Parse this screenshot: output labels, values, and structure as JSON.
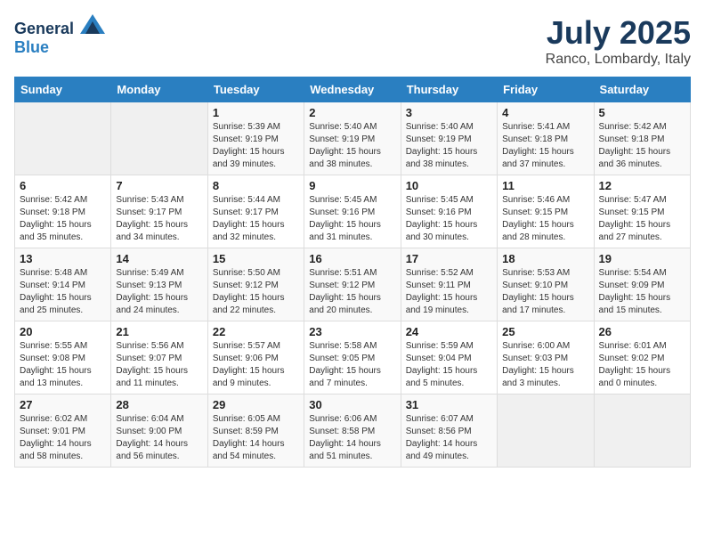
{
  "header": {
    "logo_general": "General",
    "logo_blue": "Blue",
    "month": "July 2025",
    "location": "Ranco, Lombardy, Italy"
  },
  "weekdays": [
    "Sunday",
    "Monday",
    "Tuesday",
    "Wednesday",
    "Thursday",
    "Friday",
    "Saturday"
  ],
  "weeks": [
    [
      {
        "day": "",
        "sunrise": "",
        "sunset": "",
        "daylight": ""
      },
      {
        "day": "",
        "sunrise": "",
        "sunset": "",
        "daylight": ""
      },
      {
        "day": "1",
        "sunrise": "Sunrise: 5:39 AM",
        "sunset": "Sunset: 9:19 PM",
        "daylight": "Daylight: 15 hours and 39 minutes."
      },
      {
        "day": "2",
        "sunrise": "Sunrise: 5:40 AM",
        "sunset": "Sunset: 9:19 PM",
        "daylight": "Daylight: 15 hours and 38 minutes."
      },
      {
        "day": "3",
        "sunrise": "Sunrise: 5:40 AM",
        "sunset": "Sunset: 9:19 PM",
        "daylight": "Daylight: 15 hours and 38 minutes."
      },
      {
        "day": "4",
        "sunrise": "Sunrise: 5:41 AM",
        "sunset": "Sunset: 9:18 PM",
        "daylight": "Daylight: 15 hours and 37 minutes."
      },
      {
        "day": "5",
        "sunrise": "Sunrise: 5:42 AM",
        "sunset": "Sunset: 9:18 PM",
        "daylight": "Daylight: 15 hours and 36 minutes."
      }
    ],
    [
      {
        "day": "6",
        "sunrise": "Sunrise: 5:42 AM",
        "sunset": "Sunset: 9:18 PM",
        "daylight": "Daylight: 15 hours and 35 minutes."
      },
      {
        "day": "7",
        "sunrise": "Sunrise: 5:43 AM",
        "sunset": "Sunset: 9:17 PM",
        "daylight": "Daylight: 15 hours and 34 minutes."
      },
      {
        "day": "8",
        "sunrise": "Sunrise: 5:44 AM",
        "sunset": "Sunset: 9:17 PM",
        "daylight": "Daylight: 15 hours and 32 minutes."
      },
      {
        "day": "9",
        "sunrise": "Sunrise: 5:45 AM",
        "sunset": "Sunset: 9:16 PM",
        "daylight": "Daylight: 15 hours and 31 minutes."
      },
      {
        "day": "10",
        "sunrise": "Sunrise: 5:45 AM",
        "sunset": "Sunset: 9:16 PM",
        "daylight": "Daylight: 15 hours and 30 minutes."
      },
      {
        "day": "11",
        "sunrise": "Sunrise: 5:46 AM",
        "sunset": "Sunset: 9:15 PM",
        "daylight": "Daylight: 15 hours and 28 minutes."
      },
      {
        "day": "12",
        "sunrise": "Sunrise: 5:47 AM",
        "sunset": "Sunset: 9:15 PM",
        "daylight": "Daylight: 15 hours and 27 minutes."
      }
    ],
    [
      {
        "day": "13",
        "sunrise": "Sunrise: 5:48 AM",
        "sunset": "Sunset: 9:14 PM",
        "daylight": "Daylight: 15 hours and 25 minutes."
      },
      {
        "day": "14",
        "sunrise": "Sunrise: 5:49 AM",
        "sunset": "Sunset: 9:13 PM",
        "daylight": "Daylight: 15 hours and 24 minutes."
      },
      {
        "day": "15",
        "sunrise": "Sunrise: 5:50 AM",
        "sunset": "Sunset: 9:12 PM",
        "daylight": "Daylight: 15 hours and 22 minutes."
      },
      {
        "day": "16",
        "sunrise": "Sunrise: 5:51 AM",
        "sunset": "Sunset: 9:12 PM",
        "daylight": "Daylight: 15 hours and 20 minutes."
      },
      {
        "day": "17",
        "sunrise": "Sunrise: 5:52 AM",
        "sunset": "Sunset: 9:11 PM",
        "daylight": "Daylight: 15 hours and 19 minutes."
      },
      {
        "day": "18",
        "sunrise": "Sunrise: 5:53 AM",
        "sunset": "Sunset: 9:10 PM",
        "daylight": "Daylight: 15 hours and 17 minutes."
      },
      {
        "day": "19",
        "sunrise": "Sunrise: 5:54 AM",
        "sunset": "Sunset: 9:09 PM",
        "daylight": "Daylight: 15 hours and 15 minutes."
      }
    ],
    [
      {
        "day": "20",
        "sunrise": "Sunrise: 5:55 AM",
        "sunset": "Sunset: 9:08 PM",
        "daylight": "Daylight: 15 hours and 13 minutes."
      },
      {
        "day": "21",
        "sunrise": "Sunrise: 5:56 AM",
        "sunset": "Sunset: 9:07 PM",
        "daylight": "Daylight: 15 hours and 11 minutes."
      },
      {
        "day": "22",
        "sunrise": "Sunrise: 5:57 AM",
        "sunset": "Sunset: 9:06 PM",
        "daylight": "Daylight: 15 hours and 9 minutes."
      },
      {
        "day": "23",
        "sunrise": "Sunrise: 5:58 AM",
        "sunset": "Sunset: 9:05 PM",
        "daylight": "Daylight: 15 hours and 7 minutes."
      },
      {
        "day": "24",
        "sunrise": "Sunrise: 5:59 AM",
        "sunset": "Sunset: 9:04 PM",
        "daylight": "Daylight: 15 hours and 5 minutes."
      },
      {
        "day": "25",
        "sunrise": "Sunrise: 6:00 AM",
        "sunset": "Sunset: 9:03 PM",
        "daylight": "Daylight: 15 hours and 3 minutes."
      },
      {
        "day": "26",
        "sunrise": "Sunrise: 6:01 AM",
        "sunset": "Sunset: 9:02 PM",
        "daylight": "Daylight: 15 hours and 0 minutes."
      }
    ],
    [
      {
        "day": "27",
        "sunrise": "Sunrise: 6:02 AM",
        "sunset": "Sunset: 9:01 PM",
        "daylight": "Daylight: 14 hours and 58 minutes."
      },
      {
        "day": "28",
        "sunrise": "Sunrise: 6:04 AM",
        "sunset": "Sunset: 9:00 PM",
        "daylight": "Daylight: 14 hours and 56 minutes."
      },
      {
        "day": "29",
        "sunrise": "Sunrise: 6:05 AM",
        "sunset": "Sunset: 8:59 PM",
        "daylight": "Daylight: 14 hours and 54 minutes."
      },
      {
        "day": "30",
        "sunrise": "Sunrise: 6:06 AM",
        "sunset": "Sunset: 8:58 PM",
        "daylight": "Daylight: 14 hours and 51 minutes."
      },
      {
        "day": "31",
        "sunrise": "Sunrise: 6:07 AM",
        "sunset": "Sunset: 8:56 PM",
        "daylight": "Daylight: 14 hours and 49 minutes."
      },
      {
        "day": "",
        "sunrise": "",
        "sunset": "",
        "daylight": ""
      },
      {
        "day": "",
        "sunrise": "",
        "sunset": "",
        "daylight": ""
      }
    ]
  ]
}
